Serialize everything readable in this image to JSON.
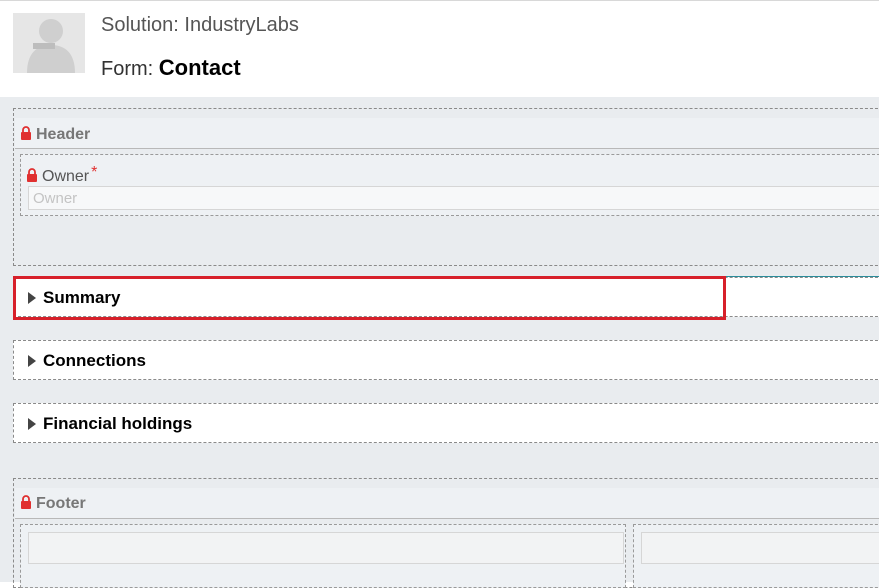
{
  "header": {
    "solution_label": "Solution: ",
    "solution_name": "IndustryLabs",
    "form_label": "Form: ",
    "form_name": "Contact"
  },
  "sections": {
    "header_title": "Header",
    "owner": {
      "label": "Owner",
      "required_mark": "*",
      "placeholder": "Owner"
    },
    "tabs": [
      {
        "label": "Summary"
      },
      {
        "label": "Connections"
      },
      {
        "label": "Financial holdings"
      }
    ],
    "footer_title": "Footer"
  },
  "colors": {
    "highlight": "#d7202a",
    "lock": "#e03030"
  }
}
